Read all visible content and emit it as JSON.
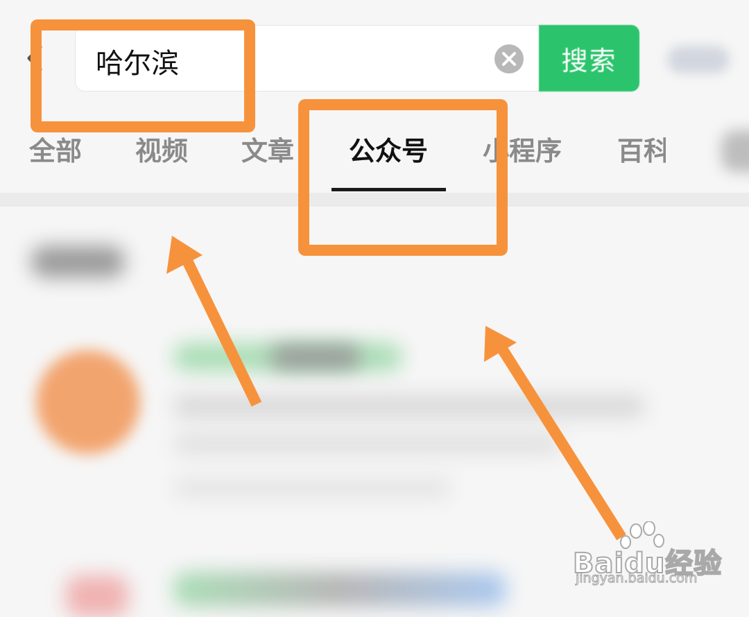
{
  "search": {
    "query": "哈尔滨",
    "button_label": "搜索"
  },
  "tabs": [
    {
      "label": "全部",
      "active": false
    },
    {
      "label": "视频",
      "active": false
    },
    {
      "label": "文章",
      "active": false
    },
    {
      "label": "公众号",
      "active": true
    },
    {
      "label": "小程序",
      "active": false
    },
    {
      "label": "百科",
      "active": false
    }
  ],
  "watermark": {
    "brand": "Baidu经验",
    "url": "jingyan.baidu.com"
  },
  "colors": {
    "accent_green": "#2bc46c",
    "annotation_orange": "#f7923c",
    "active_tab_text": "#111111",
    "inactive_tab_text": "#8a8a8a"
  },
  "icons": [
    "back-icon",
    "clear-icon",
    "baidu-paw-icon"
  ]
}
